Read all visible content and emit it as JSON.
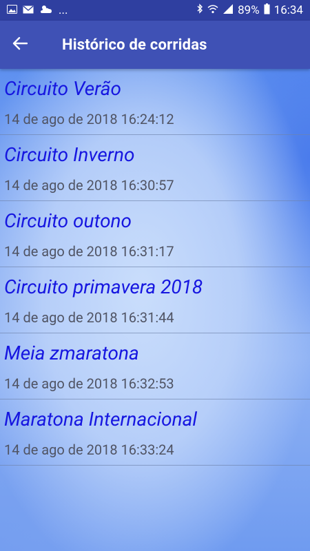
{
  "status_bar": {
    "left_extra": "...",
    "battery": "89%",
    "time": "16:34"
  },
  "app_bar": {
    "title": "Histórico de corridas"
  },
  "runs": [
    {
      "name": "Circuito Verão",
      "date": "14 de ago de 2018 16:24:12"
    },
    {
      "name": "Circuito Inverno",
      "date": "14 de ago de 2018 16:30:57"
    },
    {
      "name": "Circuito outono",
      "date": "14 de ago de 2018 16:31:17"
    },
    {
      "name": "Circuito primavera 2018",
      "date": "14 de ago de 2018 16:31:44"
    },
    {
      "name": "Meia zmaratona",
      "date": "14 de ago de 2018 16:32:53"
    },
    {
      "name": "Maratona Internacional",
      "date": "14 de ago de 2018 16:33:24"
    }
  ],
  "icons": {
    "status_left": [
      "image-icon",
      "mail-icon",
      "weather-icon"
    ],
    "status_right": [
      "bluetooth-icon",
      "wifi-icon",
      "signal-icon",
      "battery-icon"
    ],
    "back": "arrow-back-icon"
  },
  "colors": {
    "status_bar": "#2f3fa0",
    "app_bar": "#3f51b5",
    "item_title": "#1616e0",
    "item_date": "#505464"
  }
}
